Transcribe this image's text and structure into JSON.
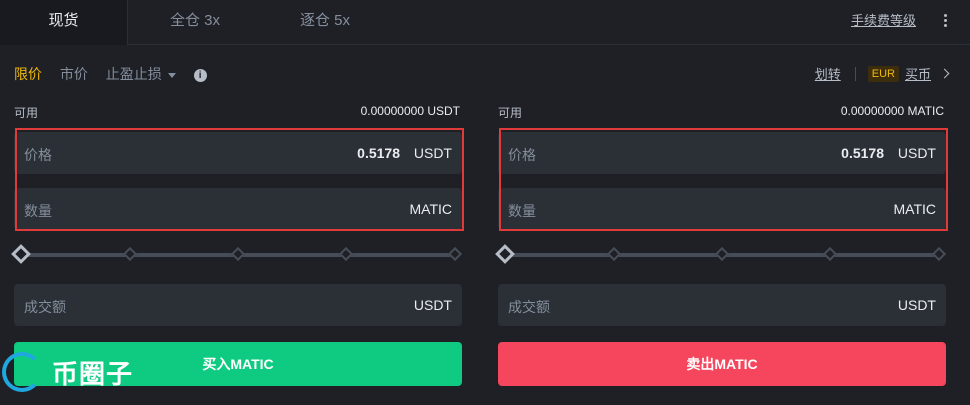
{
  "tabs": [
    {
      "label": "现货",
      "active": true
    },
    {
      "label": "全仓 3x"
    },
    {
      "label": "逐仓 5x"
    }
  ],
  "header": {
    "fee_link": "手续费等级"
  },
  "order_types": {
    "limit": "限价",
    "market": "市价",
    "stop": "止盈止损"
  },
  "right_links": {
    "transfer": "划转",
    "currency_badge": "EUR",
    "buy_crypto": "买币"
  },
  "buy": {
    "available_label": "可用",
    "available_value": "0.00000000 USDT",
    "price_label": "价格",
    "price_value": "0.5178",
    "price_unit": "USDT",
    "qty_label": "数量",
    "qty_unit": "MATIC",
    "total_label": "成交额",
    "total_unit": "USDT",
    "button": "买入MATIC",
    "slider_level": 0
  },
  "sell": {
    "available_label": "可用",
    "available_value": "0.00000000 MATIC",
    "price_label": "价格",
    "price_value": "0.5178",
    "price_unit": "USDT",
    "qty_label": "数量",
    "qty_unit": "MATIC",
    "total_label": "成交额",
    "total_unit": "USDT",
    "button": "卖出MATIC",
    "slider_level": 0
  },
  "watermark": {
    "text": "币圈子"
  },
  "colors": {
    "buy": "#0ecb81",
    "sell": "#f6465d",
    "accent": "#f0b90b",
    "highlight": "#e03a3a"
  }
}
